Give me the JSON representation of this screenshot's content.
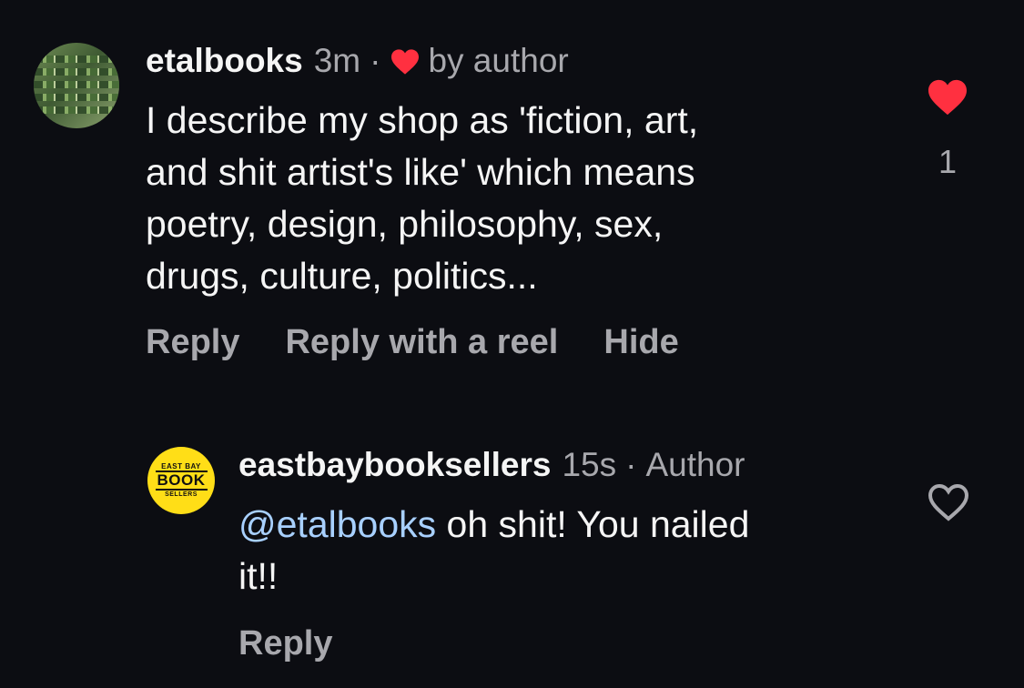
{
  "comments": [
    {
      "username": "etalbooks",
      "time": "3m",
      "separator": "·",
      "liked_by_author_label": "by author",
      "text": "I describe my shop as 'fiction, art,\nand shit artist's like' which means\npoetry, design, philosophy, sex,\ndrugs, culture, politics...",
      "actions": [
        "Reply",
        "Reply with a reel",
        "Hide"
      ],
      "like_count": "1",
      "liked": true,
      "avatar_icon": "bookshelf-avatar"
    },
    {
      "username": "eastbaybooksellers",
      "time": "15s",
      "separator": "·",
      "author_badge": "Author",
      "mention": "@etalbooks",
      "text": " oh shit! You nailed\nit!!",
      "actions": [
        "Reply"
      ],
      "liked": false,
      "avatar_text": {
        "top": "EAST BAY",
        "middle": "BOOK",
        "bottom": "SELLERS"
      }
    }
  ],
  "colors": {
    "background": "#0c0d12",
    "heart_red": "#ff3040",
    "secondary_text": "#a8a8ad",
    "mention": "#a8d0ff",
    "avatar_yellow": "#ffde17"
  }
}
